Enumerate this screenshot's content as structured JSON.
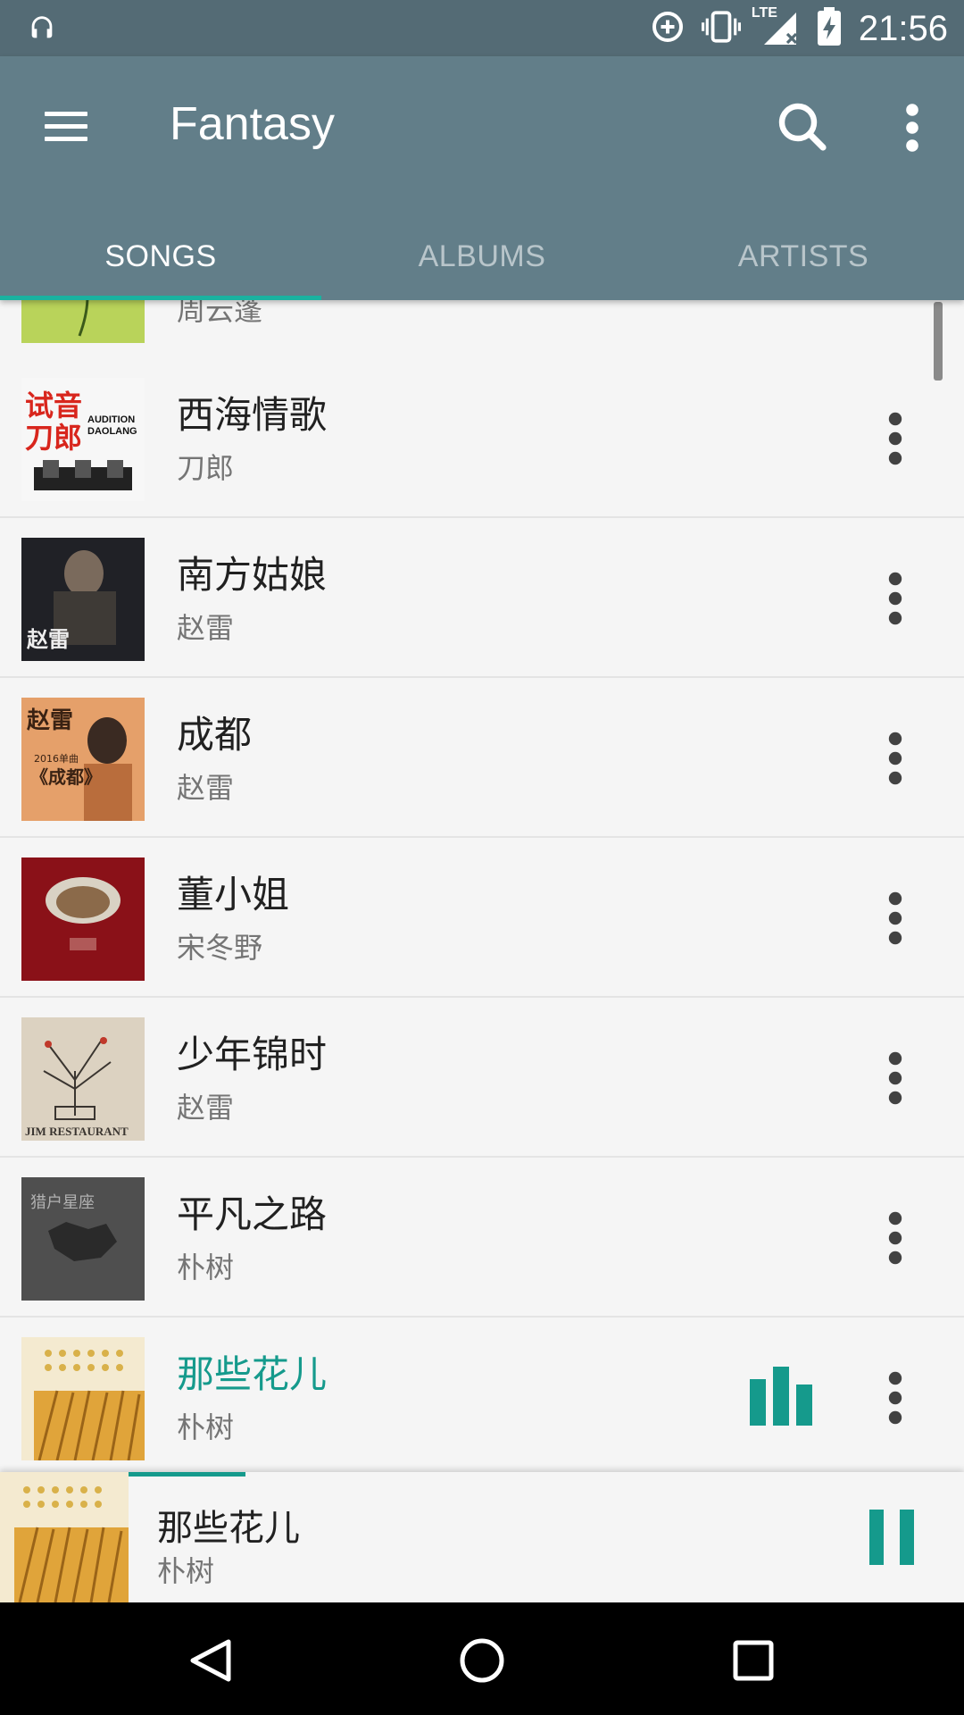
{
  "status_bar": {
    "time": "21:56",
    "network": "LTE",
    "icons": [
      "headphones-icon",
      "sync-plus-icon",
      "vibrate-icon",
      "signal-icon",
      "battery-charging-icon"
    ]
  },
  "app_bar": {
    "title": "Fantasy",
    "tabs": [
      {
        "label": "SONGS",
        "active": true
      },
      {
        "label": "ALBUMS",
        "active": false
      },
      {
        "label": "ARTISTS",
        "active": false
      }
    ]
  },
  "songs": [
    {
      "title": "",
      "artist": "周云蓬",
      "partial": true
    },
    {
      "title": "西海情歌",
      "artist": "刀郎",
      "art": "audition-daolang"
    },
    {
      "title": "南方姑娘",
      "artist": "赵雷",
      "art": "zhaolei-guitar"
    },
    {
      "title": "成都",
      "artist": "赵雷",
      "art": "chengdu"
    },
    {
      "title": "董小姐",
      "artist": "宋冬野",
      "art": "dong-xiaojie"
    },
    {
      "title": "少年锦时",
      "artist": "赵雷",
      "art": "jim-restaurant"
    },
    {
      "title": "平凡之路",
      "artist": "朴树",
      "art": "lie-hu-xing-zuo"
    },
    {
      "title": "那些花儿",
      "artist": "朴树",
      "art": "wheat",
      "playing": true
    }
  ],
  "album_art_text": {
    "audition_daolang": "试音刀郎",
    "audition_en": "AUDITION DAOLANG",
    "jim_restaurant": "JIM RESTAURANT",
    "lie_hu": "猎户星座",
    "chengdu_year": "2016单曲",
    "chengdu_title": "《成都》",
    "zhaolei": "赵雷"
  },
  "now_playing": {
    "title": "那些花儿",
    "artist": "朴树",
    "progress": 0.12
  },
  "colors": {
    "status_bar": "#546b75",
    "app_bar": "#627e89",
    "accent": "#159a8c",
    "tab_indicator": "#1ab2a0"
  }
}
